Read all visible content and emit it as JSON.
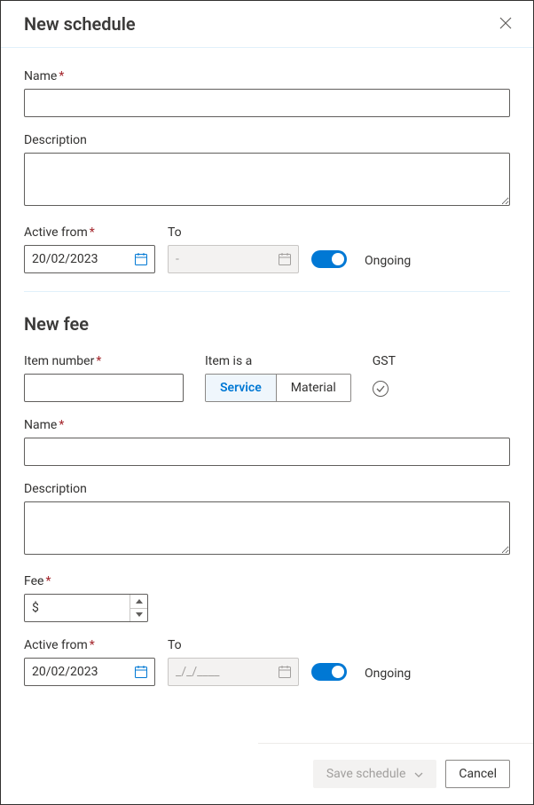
{
  "modal": {
    "title": "New schedule"
  },
  "schedule": {
    "name_label": "Name",
    "name_value": "",
    "desc_label": "Description",
    "desc_value": "",
    "active_from_label": "Active from",
    "active_from_value": "20/02/2023",
    "to_label": "To",
    "to_placeholder": "-",
    "ongoing_label": "Ongoing"
  },
  "fee_section": {
    "title": "New fee",
    "item_number_label": "Item number",
    "item_number_value": "",
    "item_is_label": "Item is a",
    "item_is_options": [
      "Service",
      "Material"
    ],
    "item_is_selected": "Service",
    "gst_label": "GST",
    "name_label": "Name",
    "name_value": "",
    "desc_label": "Description",
    "desc_value": "",
    "fee_label": "Fee",
    "fee_prefix": "$",
    "fee_value": "",
    "active_from_label": "Active from",
    "active_from_value": "20/02/2023",
    "to_label": "To",
    "to_placeholder": "_/_/____",
    "ongoing_label": "Ongoing"
  },
  "footer": {
    "save_label": "Save schedule",
    "cancel_label": "Cancel"
  }
}
